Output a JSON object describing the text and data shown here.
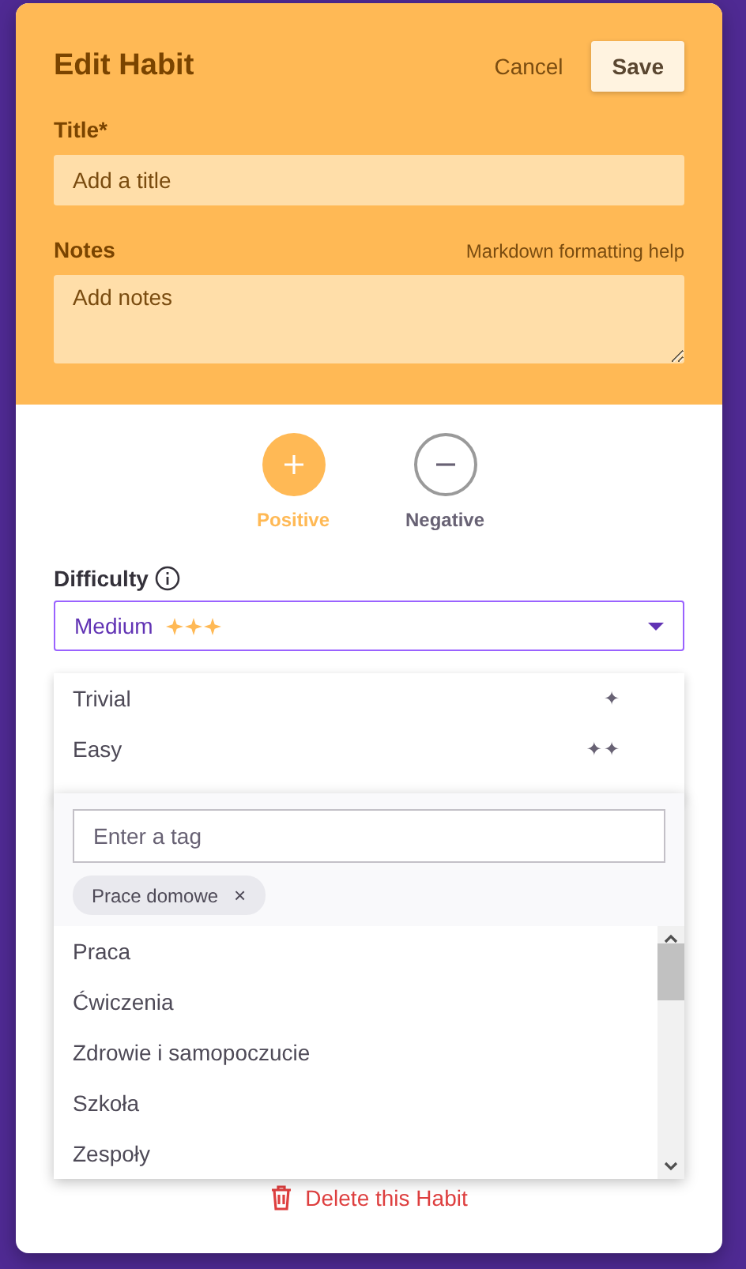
{
  "dialog": {
    "title": "Edit Habit",
    "cancel": "Cancel",
    "save": "Save"
  },
  "title_field": {
    "label": "Title*",
    "placeholder": "Add a title"
  },
  "notes_field": {
    "label": "Notes",
    "help_link": "Markdown formatting help",
    "placeholder": "Add notes"
  },
  "habit_types": [
    {
      "kind": "positive",
      "label": "Positive",
      "selected": true
    },
    {
      "kind": "negative",
      "label": "Negative",
      "selected": false
    }
  ],
  "difficulty": {
    "label": "Difficulty",
    "value": "Medium",
    "stars": 3,
    "options": [
      {
        "label": "Trivial",
        "marker": "✦"
      },
      {
        "label": "Easy",
        "marker": "✦✦"
      }
    ]
  },
  "tag_picker": {
    "placeholder": "Enter a tag",
    "chips": [
      {
        "label": "Prace domowe",
        "remove": "×"
      }
    ],
    "options": [
      "Praca",
      "Ćwiczenia",
      "Zdrowie i samopoczucie",
      "Szkoła",
      "Zespoły"
    ]
  },
  "delete_label": "Delete this Habit"
}
